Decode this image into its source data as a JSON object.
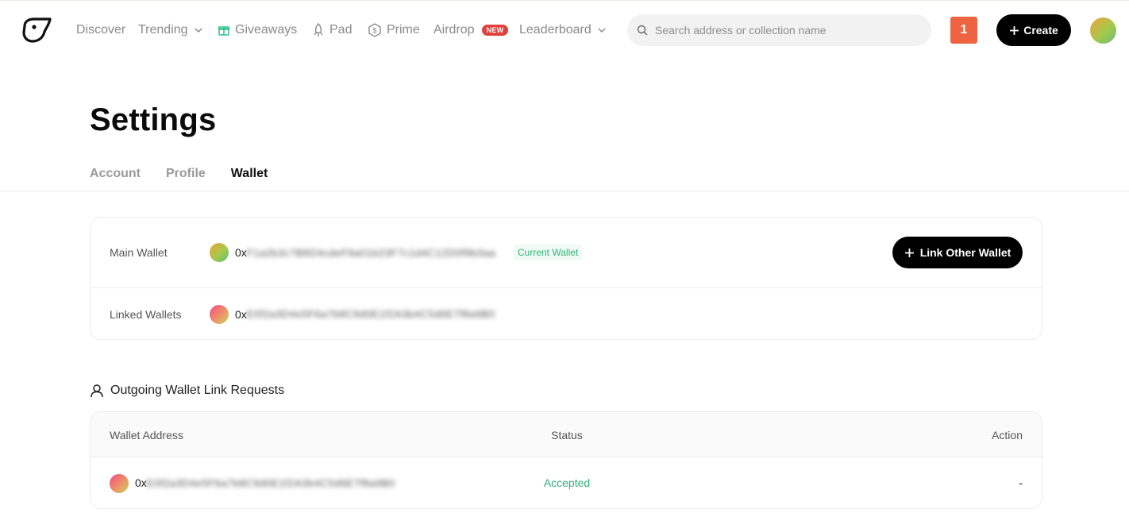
{
  "nav": {
    "items": [
      {
        "label": "Discover",
        "icon": "none"
      },
      {
        "label": "Trending",
        "icon": "chevron-down-icon"
      },
      {
        "label": "Giveaways",
        "icon": "gift-icon"
      },
      {
        "label": "Pad",
        "icon": "rocket-icon"
      },
      {
        "label": "Prime",
        "icon": "prime-shield-icon"
      },
      {
        "label": "Airdrop",
        "badge": "NEW"
      },
      {
        "label": "Leaderboard",
        "icon": "chevron-down-icon"
      }
    ],
    "search_placeholder": "Search address or collection name",
    "notification_count": "1",
    "create_label": "Create"
  },
  "page": {
    "title": "Settings",
    "tabs": [
      {
        "label": "Account",
        "active": false
      },
      {
        "label": "Profile",
        "active": false
      },
      {
        "label": "Wallet",
        "active": true
      }
    ]
  },
  "wallets": {
    "main_label": "Main Wallet",
    "main_address_prefix": "0x",
    "main_address_blurred": "F1a2b3c7B8D4cdeF9a01b23F7c1d4C12D0f9b3aa",
    "current_badge": "Current Wallet",
    "link_button": "Link Other Wallet",
    "linked_label": "Linked Wallets",
    "linked_address_prefix": "0x",
    "linked_address_blurred": "E0f2a3D4e5F6a7b8C9d0E1f2A3b4C5d6E7f8a9B0"
  },
  "outgoing": {
    "title": "Outgoing Wallet Link Requests",
    "columns": [
      "Wallet Address",
      "Status",
      "Action"
    ],
    "rows": [
      {
        "address_prefix": "0x",
        "address_blurred": "E0f2a3D4e5F6a7b8C9d0E1f2A3b4C5d6E7f8a9B0",
        "status": "Accepted",
        "action": "-"
      }
    ]
  },
  "colors": {
    "accent_black": "#000000",
    "notification": "#ee6443",
    "status_green": "#2fae75",
    "badge_red": "#e0413b"
  }
}
